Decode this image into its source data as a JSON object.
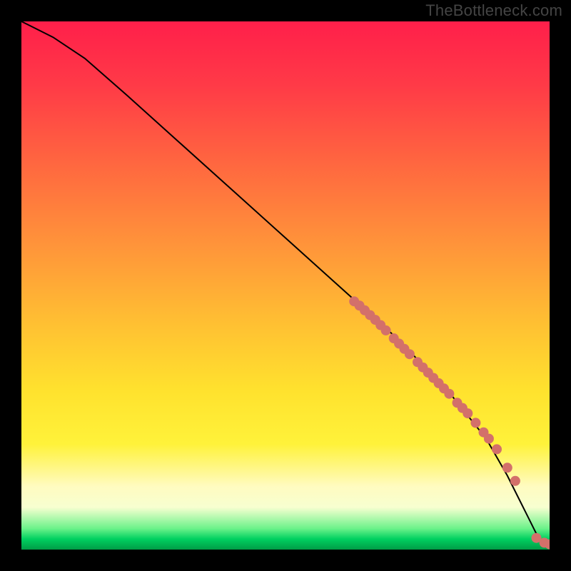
{
  "watermark": "TheBottleneck.com",
  "chart_data": {
    "type": "line",
    "title": "",
    "xlabel": "",
    "ylabel": "",
    "xlim": [
      0,
      100
    ],
    "ylim": [
      0,
      100
    ],
    "grid": false,
    "legend": false,
    "line_color": "#000000",
    "marker_color": "#d3706a",
    "x": [
      0,
      2,
      6,
      12,
      20,
      30,
      40,
      50,
      60,
      70,
      80,
      88,
      92,
      94,
      96,
      97,
      98,
      99,
      100
    ],
    "y": [
      100,
      99,
      97,
      93,
      86,
      77,
      68,
      59,
      50,
      41,
      31,
      21,
      14,
      10,
      6,
      4,
      2,
      1,
      1
    ],
    "highlighted_x": [
      63,
      64,
      65,
      66,
      67,
      68,
      69,
      70.5,
      71.5,
      72.5,
      73.5,
      75,
      76,
      77,
      78,
      79,
      80,
      81,
      82.5,
      83.5,
      84.5,
      86,
      87.5,
      88.5,
      90,
      92,
      93.5,
      97.5,
      99,
      100
    ],
    "highlighted_y": [
      47,
      46.2,
      45.3,
      44.4,
      43.5,
      42.5,
      41.5,
      40,
      39,
      38,
      37,
      35.5,
      34.5,
      33.5,
      32.5,
      31.5,
      30.5,
      29.5,
      27.8,
      26.8,
      25.8,
      24,
      22.2,
      21,
      19,
      15.5,
      13,
      2.2,
      1.3,
      1
    ]
  }
}
